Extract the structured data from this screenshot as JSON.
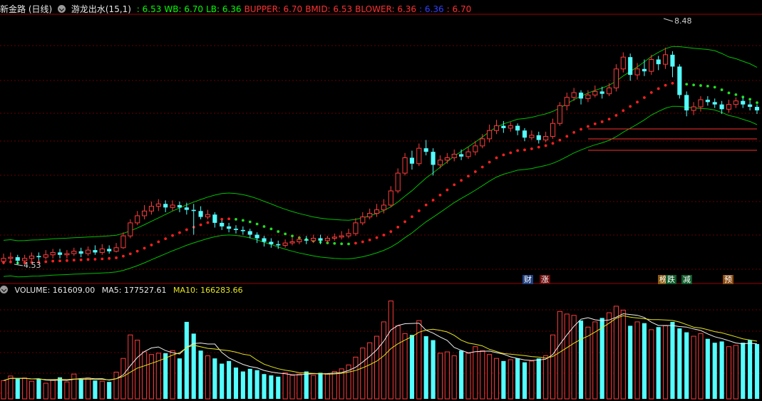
{
  "header": {
    "stock_name": "新金路",
    "period": "(日线)",
    "indicator_name": "游龙出水(15,1)",
    "values": [
      {
        "label": ": 6.53",
        "color": "#00ff00"
      },
      {
        "label": "WB: 6.70",
        "color": "#00ff00"
      },
      {
        "label": "LB: 6.36",
        "color": "#00ff00"
      },
      {
        "label": "BUPPER: 6.70",
        "color": "#ff3030"
      },
      {
        "label": "BMID: 6.53",
        "color": "#ff3030"
      },
      {
        "label": "BLOWER: 6.36",
        "color": "#ff3030"
      },
      {
        "label": ": 6.36",
        "color": "#3040ff"
      },
      {
        "label": ": 6.70",
        "color": "#ff3030"
      }
    ]
  },
  "volume_header": {
    "volume": "VOLUME: 161609.00",
    "ma5": "MA5: 177527.61",
    "ma10": "MA10: 166283.66"
  },
  "labels": {
    "peak": "8.48",
    "low": "4.53"
  },
  "badges": [
    {
      "text": "财",
      "bg": "#1f3f7f",
      "fg": "#ffffff"
    },
    {
      "text": "涨",
      "bg": "#6a0c0c",
      "fg": "#ffffff"
    },
    {
      "text": "榜",
      "bg": "#8a5a10",
      "fg": "#ffffff"
    },
    {
      "text": "跌",
      "bg": "#0f5a2a",
      "fg": "#ffffff"
    },
    {
      "text": "减",
      "bg": "#0f5a2a",
      "fg": "#ffffff"
    },
    {
      "text": "预",
      "bg": "#8a4a10",
      "fg": "#ffffff"
    }
  ],
  "colors": {
    "up": "#ff3c3c",
    "down": "#54ffff",
    "grid": "#6a0000",
    "band": "#00c000",
    "ma5": "#f0f0f0",
    "ma10": "#e6e61e"
  },
  "chart_data": {
    "type": "candlestick",
    "ylim": [
      4.3,
      8.8
    ],
    "candles": [
      [
        4.65,
        4.7,
        4.78,
        4.6
      ],
      [
        4.7,
        4.72,
        4.8,
        4.64
      ],
      [
        4.72,
        4.66,
        4.76,
        4.6
      ],
      [
        4.66,
        4.7,
        4.76,
        4.62
      ],
      [
        4.7,
        4.74,
        4.8,
        4.66
      ],
      [
        4.74,
        4.72,
        4.8,
        4.66
      ],
      [
        4.72,
        4.76,
        4.84,
        4.68
      ],
      [
        4.76,
        4.8,
        4.86,
        4.7
      ],
      [
        4.8,
        4.76,
        4.86,
        4.7
      ],
      [
        4.76,
        4.78,
        4.84,
        4.7
      ],
      [
        4.78,
        4.82,
        4.88,
        4.74
      ],
      [
        4.82,
        4.78,
        4.88,
        4.72
      ],
      [
        4.78,
        4.84,
        4.9,
        4.74
      ],
      [
        4.84,
        4.8,
        4.92,
        4.76
      ],
      [
        4.8,
        4.86,
        4.94,
        4.76
      ],
      [
        4.86,
        4.82,
        4.92,
        4.78
      ],
      [
        4.82,
        4.88,
        4.96,
        4.8
      ],
      [
        4.88,
        5.08,
        5.14,
        4.86
      ],
      [
        5.08,
        5.3,
        5.36,
        5.04
      ],
      [
        5.3,
        5.42,
        5.5,
        5.26
      ],
      [
        5.42,
        5.5,
        5.6,
        5.36
      ],
      [
        5.5,
        5.58,
        5.66,
        5.44
      ],
      [
        5.58,
        5.62,
        5.7,
        5.5
      ],
      [
        5.62,
        5.56,
        5.68,
        5.48
      ],
      [
        5.56,
        5.6,
        5.68,
        5.5
      ],
      [
        5.6,
        5.56,
        5.66,
        5.48
      ],
      [
        5.56,
        5.52,
        5.64,
        5.44
      ],
      [
        5.52,
        5.5,
        5.62,
        5.1
      ],
      [
        5.5,
        5.4,
        5.58,
        5.36
      ],
      [
        5.4,
        5.44,
        5.52,
        5.36
      ],
      [
        5.44,
        5.3,
        5.48,
        5.22
      ],
      [
        5.3,
        5.24,
        5.34,
        5.18
      ],
      [
        5.24,
        5.2,
        5.3,
        5.14
      ],
      [
        5.2,
        5.18,
        5.26,
        5.12
      ],
      [
        5.18,
        5.16,
        5.24,
        5.1
      ],
      [
        5.16,
        5.1,
        5.2,
        5.04
      ],
      [
        5.1,
        5.04,
        5.14,
        4.96
      ],
      [
        5.04,
        4.98,
        5.08,
        4.9
      ],
      [
        4.98,
        4.94,
        5.04,
        4.88
      ],
      [
        4.94,
        4.92,
        5.0,
        4.86
      ],
      [
        4.92,
        4.96,
        5.02,
        4.88
      ],
      [
        4.96,
        4.98,
        5.06,
        4.92
      ],
      [
        4.98,
        5.02,
        5.08,
        4.94
      ],
      [
        5.02,
        5.0,
        5.08,
        4.94
      ],
      [
        5.0,
        5.04,
        5.1,
        4.96
      ],
      [
        5.04,
        5.0,
        5.1,
        4.94
      ],
      [
        5.0,
        5.04,
        5.08,
        4.96
      ],
      [
        5.04,
        5.06,
        5.12,
        5.0
      ],
      [
        5.06,
        5.08,
        5.16,
        5.02
      ],
      [
        5.08,
        5.12,
        5.2,
        5.04
      ],
      [
        5.12,
        5.3,
        5.38,
        5.08
      ],
      [
        5.3,
        5.4,
        5.48,
        5.26
      ],
      [
        5.4,
        5.46,
        5.54,
        5.36
      ],
      [
        5.46,
        5.52,
        5.62,
        5.4
      ],
      [
        5.52,
        5.6,
        5.7,
        5.46
      ],
      [
        5.6,
        5.84,
        5.92,
        5.56
      ],
      [
        5.84,
        6.14,
        6.22,
        5.8
      ],
      [
        6.14,
        6.4,
        6.48,
        6.1
      ],
      [
        6.4,
        6.3,
        6.52,
        6.2
      ],
      [
        6.3,
        6.56,
        6.64,
        6.26
      ],
      [
        6.56,
        6.5,
        6.7,
        6.44
      ],
      [
        6.5,
        6.28,
        6.56,
        6.1
      ],
      [
        6.28,
        6.36,
        6.44,
        6.22
      ],
      [
        6.36,
        6.4,
        6.48,
        6.3
      ],
      [
        6.4,
        6.46,
        6.54,
        6.34
      ],
      [
        6.46,
        6.42,
        6.54,
        6.36
      ],
      [
        6.42,
        6.5,
        6.58,
        6.38
      ],
      [
        6.5,
        6.6,
        6.68,
        6.44
      ],
      [
        6.6,
        6.72,
        6.8,
        6.56
      ],
      [
        6.72,
        6.86,
        6.96,
        6.66
      ],
      [
        6.86,
        6.94,
        7.04,
        6.8
      ],
      [
        6.94,
        6.9,
        7.02,
        6.82
      ],
      [
        6.9,
        6.94,
        7.0,
        6.84
      ],
      [
        6.94,
        6.86,
        6.98,
        6.78
      ],
      [
        6.86,
        6.74,
        6.9,
        6.68
      ],
      [
        6.74,
        6.78,
        6.86,
        6.7
      ],
      [
        6.78,
        6.7,
        6.84,
        6.64
      ],
      [
        6.7,
        6.76,
        6.84,
        6.66
      ],
      [
        6.76,
        6.98,
        7.06,
        6.72
      ],
      [
        6.98,
        7.28,
        7.34,
        6.94
      ],
      [
        7.28,
        7.42,
        7.5,
        7.2
      ],
      [
        7.42,
        7.5,
        7.58,
        7.36
      ],
      [
        7.5,
        7.4,
        7.54,
        7.3
      ],
      [
        7.4,
        7.46,
        7.54,
        7.34
      ],
      [
        7.46,
        7.52,
        7.62,
        7.42
      ],
      [
        7.52,
        7.48,
        7.6,
        7.4
      ],
      [
        7.48,
        7.58,
        7.66,
        7.44
      ],
      [
        7.58,
        7.9,
        7.98,
        7.52
      ],
      [
        7.9,
        8.1,
        8.18,
        7.84
      ],
      [
        8.1,
        7.8,
        8.16,
        7.7
      ],
      [
        7.8,
        7.9,
        8.0,
        7.72
      ],
      [
        7.9,
        7.86,
        8.06,
        7.78
      ],
      [
        7.86,
        8.06,
        8.14,
        7.8
      ],
      [
        8.06,
        7.98,
        8.12,
        7.88
      ],
      [
        7.98,
        8.14,
        8.26,
        7.9
      ],
      [
        8.14,
        7.94,
        8.2,
        7.76
      ],
      [
        7.94,
        7.46,
        7.98,
        7.4
      ],
      [
        7.46,
        7.2,
        7.52,
        7.1
      ],
      [
        7.2,
        7.26,
        7.34,
        7.12
      ],
      [
        7.26,
        7.38,
        7.44,
        7.18
      ],
      [
        7.38,
        7.34,
        7.44,
        7.28
      ],
      [
        7.34,
        7.3,
        7.4,
        7.24
      ],
      [
        7.3,
        7.22,
        7.36,
        7.14
      ],
      [
        7.22,
        7.3,
        7.38,
        7.16
      ],
      [
        7.3,
        7.36,
        7.42,
        7.24
      ],
      [
        7.36,
        7.3,
        7.42,
        7.24
      ],
      [
        7.3,
        7.26,
        7.36,
        7.2
      ],
      [
        7.26,
        7.2,
        7.3,
        7.14
      ]
    ],
    "volume": [
      28,
      35,
      31,
      32,
      27,
      30,
      24,
      29,
      33,
      26,
      38,
      30,
      32,
      28,
      27,
      26,
      41,
      62,
      98,
      90,
      72,
      68,
      70,
      70,
      74,
      62,
      118,
      100,
      74,
      66,
      62,
      54,
      58,
      48,
      42,
      46,
      44,
      38,
      36,
      34,
      40,
      36,
      38,
      42,
      36,
      40,
      38,
      42,
      46,
      52,
      64,
      78,
      86,
      96,
      118,
      150,
      112,
      100,
      98,
      120,
      96,
      90,
      70,
      72,
      66,
      74,
      70,
      80,
      74,
      68,
      62,
      58,
      60,
      62,
      56,
      58,
      62,
      66,
      98,
      134,
      130,
      128,
      120,
      110,
      118,
      124,
      132,
      142,
      136,
      112,
      118,
      116,
      106,
      110,
      112,
      118,
      108,
      102,
      96,
      100,
      92,
      86,
      88,
      80,
      82,
      86,
      90,
      84
    ],
    "series": [
      {
        "name": "VOLUME",
        "values": []
      }
    ]
  }
}
